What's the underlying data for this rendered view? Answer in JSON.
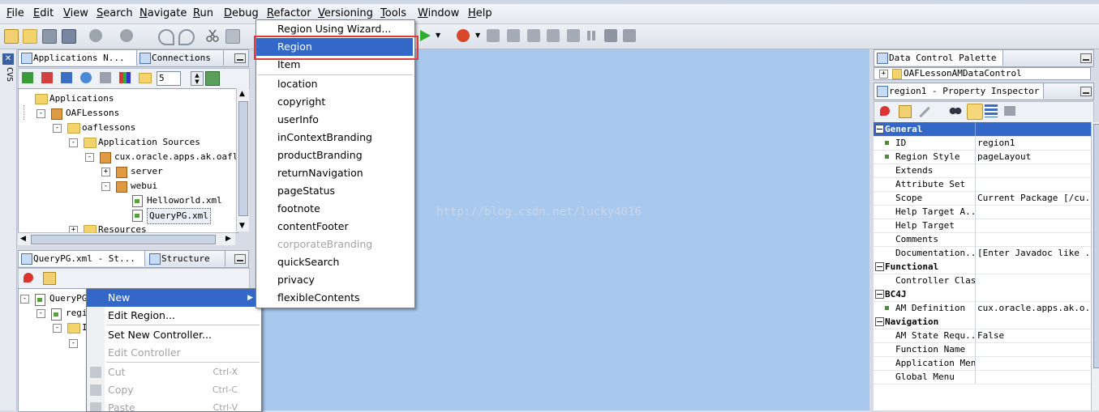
{
  "menubar": {
    "items": [
      "File",
      "Edit",
      "View",
      "Search",
      "Navigate",
      "Run",
      "Debug",
      "Refactor",
      "Versioning",
      "Tools",
      "Window",
      "Help"
    ]
  },
  "toolbar": {
    "spinner_value": "5"
  },
  "side_tab": {
    "label": "CVS"
  },
  "app_navigator": {
    "tab_applications": "Applications N...",
    "tab_connections": "Connections",
    "depth_value": "5",
    "tree": [
      {
        "label": "Applications"
      },
      {
        "label": "OAFLessons"
      },
      {
        "label": "oaflessons"
      },
      {
        "label": "Application Sources"
      },
      {
        "label": "cux.oracle.apps.ak.oaflesson"
      },
      {
        "label": "server"
      },
      {
        "label": "webui"
      },
      {
        "label": "Helloworld.xml"
      },
      {
        "label": "QueryPG.xml"
      },
      {
        "label": "Resources"
      }
    ]
  },
  "structure_panel": {
    "tab_querypg": "QueryPG.xml - St...",
    "tab_structure": "Structure",
    "tree": [
      {
        "label": "QueryPG"
      },
      {
        "label": "regi"
      },
      {
        "label": "I"
      }
    ]
  },
  "context_menu": {
    "items": [
      {
        "label": "New",
        "selected": true,
        "submenu": true
      },
      {
        "label": "Edit Region..."
      },
      {
        "label": "Set New Controller..."
      },
      {
        "label": "Edit Controller",
        "disabled": true
      },
      {
        "label": "Cut",
        "shortcut": "Ctrl-X",
        "disabled": true
      },
      {
        "label": "Copy",
        "shortcut": "Ctrl-C",
        "disabled": true
      },
      {
        "label": "Paste",
        "shortcut": "Ctrl-V",
        "disabled": true
      }
    ]
  },
  "submenu": {
    "items": [
      {
        "label": "Region Using Wizard..."
      },
      {
        "label": "Region",
        "selected": true
      },
      {
        "label": "Item"
      },
      {
        "label": "location"
      },
      {
        "label": "copyright"
      },
      {
        "label": "userInfo"
      },
      {
        "label": "inContextBranding"
      },
      {
        "label": "productBranding"
      },
      {
        "label": "returnNavigation"
      },
      {
        "label": "pageStatus"
      },
      {
        "label": "footnote"
      },
      {
        "label": "contentFooter"
      },
      {
        "label": "corporateBranding",
        "disabled": true
      },
      {
        "label": "quickSearch"
      },
      {
        "label": "privacy"
      },
      {
        "label": "flexibleContents"
      }
    ]
  },
  "watermark": "http://blog.csdn.net/lucky4016",
  "data_control_palette": {
    "tab": "Data Control Palette",
    "item": "OAFLessonAMDataControl"
  },
  "property_inspector": {
    "tab": "region1 - Property Inspector",
    "rows": [
      {
        "cat": "General",
        "selected": true
      },
      {
        "key": "ID",
        "value": "region1",
        "required": true
      },
      {
        "key": "Region Style",
        "value": "pageLayout",
        "required": true
      },
      {
        "key": "Extends",
        "value": ""
      },
      {
        "key": "Attribute Set",
        "value": ""
      },
      {
        "key": "Scope",
        "value": "Current Package [/cu..."
      },
      {
        "key": "Help Target A...",
        "value": ""
      },
      {
        "key": "Help Target",
        "value": ""
      },
      {
        "key": "Comments",
        "value": ""
      },
      {
        "key": "Documentation...",
        "value": "[Enter Javadoc like ..."
      },
      {
        "cat": "Functional"
      },
      {
        "key": "Controller Class",
        "value": ""
      },
      {
        "cat": "BC4J"
      },
      {
        "key": "AM Definition",
        "value": "cux.oracle.apps.ak.o...",
        "required": true
      },
      {
        "cat": "Navigation"
      },
      {
        "key": "AM State Requ...",
        "value": "False"
      },
      {
        "key": "Function Name",
        "value": ""
      },
      {
        "key": "Application Menu",
        "value": ""
      },
      {
        "key": "Global Menu",
        "value": ""
      }
    ]
  },
  "colors": {
    "canvas": "#a8c8ee",
    "selection": "#3468c8",
    "highlight_box": "#e03a3a"
  }
}
